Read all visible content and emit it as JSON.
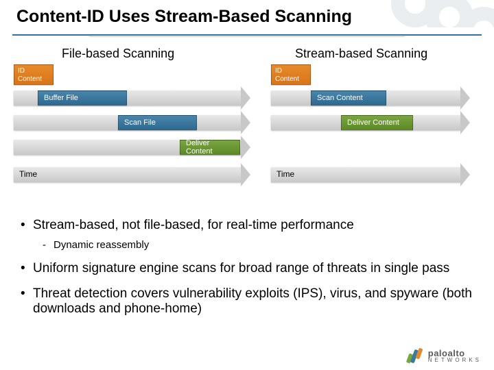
{
  "title": "Content-ID Uses Stream-Based Scanning",
  "left": {
    "heading": "File-based Scanning",
    "id_label": "ID Content",
    "step_buffer": "Buffer File",
    "step_scan": "Scan File",
    "step_deliver": "Deliver Content",
    "time": "Time"
  },
  "right": {
    "heading": "Stream-based Scanning",
    "id_label": "ID Content",
    "step_scan": "Scan Content",
    "step_deliver": "Deliver Content",
    "time": "Time"
  },
  "bullets": {
    "b1": "Stream-based, not file-based, for real-time performance",
    "b1a": "Dynamic reassembly",
    "b2": "Uniform signature engine scans for broad range of threats in single pass",
    "b3": "Threat detection covers vulnerability exploits (IPS), virus, and spyware (both downloads and phone-home)"
  },
  "brand": {
    "name": "paloalto",
    "sub": "NETWORKS"
  },
  "colors": {
    "blue": "#2e6a90",
    "orange": "#d97418",
    "green": "#5c8a26"
  }
}
